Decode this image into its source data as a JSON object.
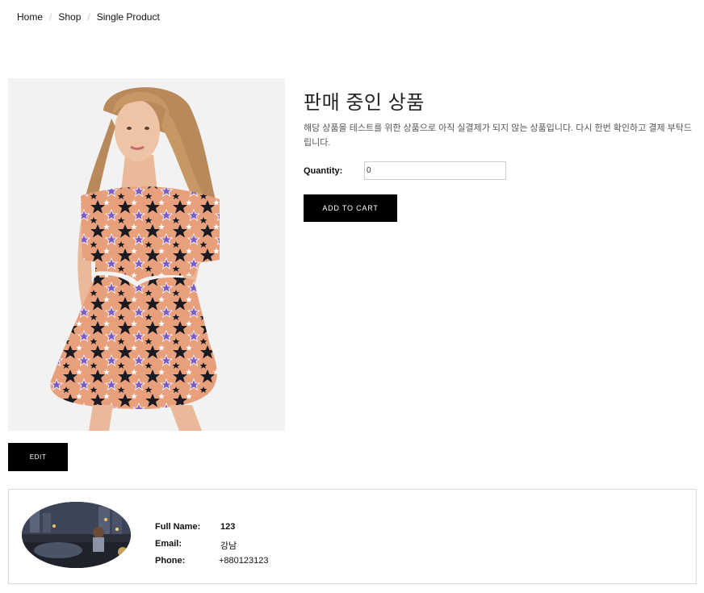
{
  "breadcrumb": {
    "items": [
      "Home",
      "Shop",
      "Single Product"
    ],
    "separator": "/"
  },
  "product": {
    "title": "판매 중인 상품",
    "description": "해당 상품을 테스트를 위한 상품으로 아직 실결제가 되지 않는 상품입니다. 다시 한번 확인하고 결제 부탁드립니다.",
    "quantity_label": "Quantity:",
    "quantity_value": "0",
    "add_to_cart_label": "ADD TO CART",
    "edit_label": "EDIT"
  },
  "user": {
    "full_name_label": "Full Name:",
    "full_name_value": "123",
    "email_label": "Email:",
    "email_value": "강남",
    "phone_label": "Phone:",
    "phone_value": "+880123123"
  },
  "colors": {
    "button_bg": "#000000",
    "button_text": "#ffffff",
    "dress_base": "#e8a07c",
    "dress_star_dark": "#1a1a22",
    "dress_star_purple": "#7b5cc4"
  }
}
